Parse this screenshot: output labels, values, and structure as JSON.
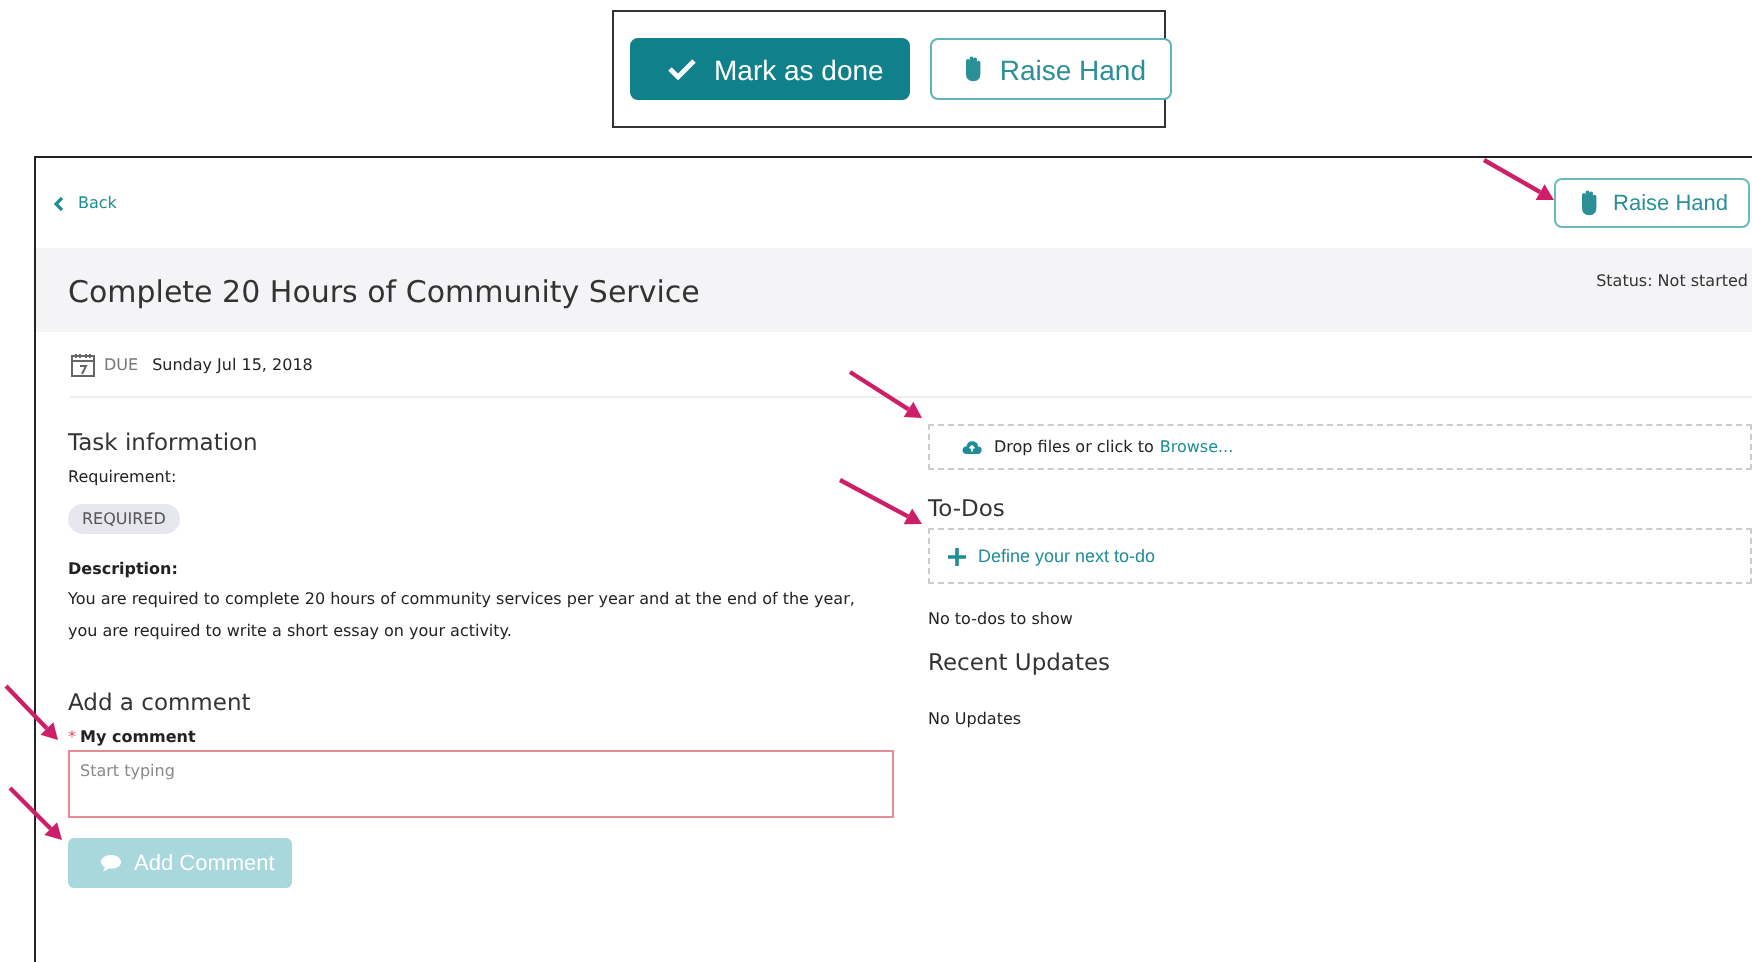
{
  "top_actions": [
    {
      "kind": "primary",
      "label": "Mark as done"
    },
    {
      "kind": "outline",
      "label": "Raise Hand"
    }
  ],
  "header": {
    "back": "Back",
    "raise_hand": "Raise Hand"
  },
  "task": {
    "title": "Complete 20 Hours of Community Service",
    "status": "Status: Not started",
    "due_label": "DUE",
    "due_date": "Sunday Jul 15, 2018"
  },
  "task_information": {
    "heading": "Task information",
    "requirement_label": "Requirement:",
    "requirement": "REQUIRED",
    "description_label": "Description:",
    "description": "You are required to complete 20 hours of community services per year and at the end of the year, you are required to write a short essay on your activity."
  },
  "comment": {
    "heading": "Add a comment",
    "required_mark": "*",
    "label": "My comment",
    "placeholder": "Start typing",
    "invalid": true,
    "button": "Add Comment",
    "disabled": true
  },
  "upload": {
    "text": "Drop files or click to",
    "link": "Browse..."
  },
  "todos": {
    "heading": "To-Dos",
    "add": "Define your next to-do",
    "empty": "No to-dos to show"
  },
  "updates": {
    "heading": "Recent Updates",
    "empty": "No Updates"
  }
}
